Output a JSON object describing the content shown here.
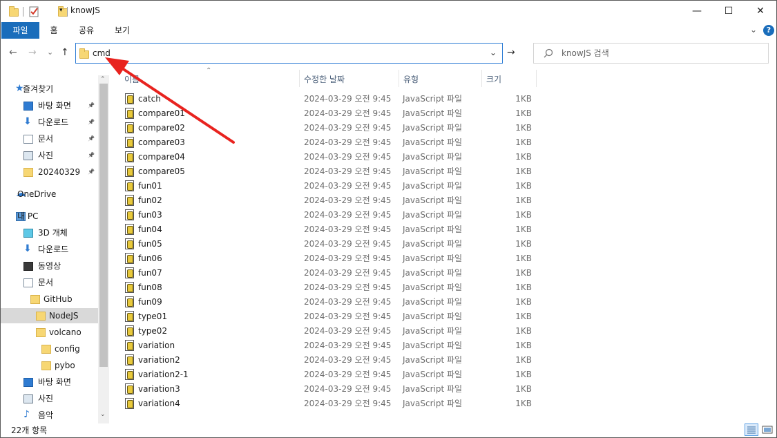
{
  "window": {
    "title": "knowJS",
    "minimize": "—",
    "maximize": "☐",
    "close": "✕"
  },
  "ribbon": {
    "tabs": [
      "파일",
      "홈",
      "공유",
      "보기"
    ],
    "expand_glyph": "⌄",
    "help_glyph": "?"
  },
  "navbar": {
    "back": "←",
    "forward": "→",
    "recent": "⌄",
    "up": "↑",
    "address": "cmd",
    "address_dropdown": "⌄",
    "go": "→",
    "search_placeholder": "knowJS 검색",
    "search_icon": "search-icon"
  },
  "sidebar": {
    "items": [
      {
        "label": "즐겨찾기",
        "icon": "star-icon",
        "pinned": false
      },
      {
        "label": "바탕 화면",
        "icon": "desktop-icon",
        "pinned": true
      },
      {
        "label": "다운로드",
        "icon": "download-icon",
        "pinned": true
      },
      {
        "label": "문서",
        "icon": "document-icon",
        "pinned": true
      },
      {
        "label": "사진",
        "icon": "picture-icon",
        "pinned": true
      },
      {
        "label": "20240329",
        "icon": "folder-icon",
        "pinned": true
      },
      {
        "label": "OneDrive",
        "icon": "cloud-icon",
        "pinned": false
      },
      {
        "label": "내 PC",
        "icon": "pc-icon",
        "pinned": false
      },
      {
        "label": "3D 개체",
        "icon": "3d-objects-icon",
        "pinned": false
      },
      {
        "label": "다운로드",
        "icon": "download-icon",
        "pinned": false
      },
      {
        "label": "동영상",
        "icon": "video-icon",
        "pinned": false
      },
      {
        "label": "문서",
        "icon": "document-icon",
        "pinned": false
      },
      {
        "label": "GitHub",
        "icon": "folder-icon",
        "pinned": false
      },
      {
        "label": "NodeJS",
        "icon": "folder-icon",
        "pinned": false,
        "selected": true
      },
      {
        "label": "volcano",
        "icon": "folder-icon",
        "pinned": false
      },
      {
        "label": "config",
        "icon": "folder-icon",
        "pinned": false
      },
      {
        "label": "pybo",
        "icon": "folder-icon",
        "pinned": false
      },
      {
        "label": "바탕 화면",
        "icon": "desktop-icon",
        "pinned": false
      },
      {
        "label": "사진",
        "icon": "picture-icon",
        "pinned": false
      },
      {
        "label": "음악",
        "icon": "music-icon",
        "pinned": false
      }
    ]
  },
  "columns": {
    "name": "이름",
    "date": "수정한 날짜",
    "type": "유형",
    "size": "크기"
  },
  "files": [
    {
      "name": "catch",
      "date": "2024-03-29 오전 9:45",
      "type": "JavaScript 파일",
      "size": "1KB"
    },
    {
      "name": "compare01",
      "date": "2024-03-29 오전 9:45",
      "type": "JavaScript 파일",
      "size": "1KB"
    },
    {
      "name": "compare02",
      "date": "2024-03-29 오전 9:45",
      "type": "JavaScript 파일",
      "size": "1KB"
    },
    {
      "name": "compare03",
      "date": "2024-03-29 오전 9:45",
      "type": "JavaScript 파일",
      "size": "1KB"
    },
    {
      "name": "compare04",
      "date": "2024-03-29 오전 9:45",
      "type": "JavaScript 파일",
      "size": "1KB"
    },
    {
      "name": "compare05",
      "date": "2024-03-29 오전 9:45",
      "type": "JavaScript 파일",
      "size": "1KB"
    },
    {
      "name": "fun01",
      "date": "2024-03-29 오전 9:45",
      "type": "JavaScript 파일",
      "size": "1KB"
    },
    {
      "name": "fun02",
      "date": "2024-03-29 오전 9:45",
      "type": "JavaScript 파일",
      "size": "1KB"
    },
    {
      "name": "fun03",
      "date": "2024-03-29 오전 9:45",
      "type": "JavaScript 파일",
      "size": "1KB"
    },
    {
      "name": "fun04",
      "date": "2024-03-29 오전 9:45",
      "type": "JavaScript 파일",
      "size": "1KB"
    },
    {
      "name": "fun05",
      "date": "2024-03-29 오전 9:45",
      "type": "JavaScript 파일",
      "size": "1KB"
    },
    {
      "name": "fun06",
      "date": "2024-03-29 오전 9:45",
      "type": "JavaScript 파일",
      "size": "1KB"
    },
    {
      "name": "fun07",
      "date": "2024-03-29 오전 9:45",
      "type": "JavaScript 파일",
      "size": "1KB"
    },
    {
      "name": "fun08",
      "date": "2024-03-29 오전 9:45",
      "type": "JavaScript 파일",
      "size": "1KB"
    },
    {
      "name": "fun09",
      "date": "2024-03-29 오전 9:45",
      "type": "JavaScript 파일",
      "size": "1KB"
    },
    {
      "name": "type01",
      "date": "2024-03-29 오전 9:45",
      "type": "JavaScript 파일",
      "size": "1KB"
    },
    {
      "name": "type02",
      "date": "2024-03-29 오전 9:45",
      "type": "JavaScript 파일",
      "size": "1KB"
    },
    {
      "name": "variation",
      "date": "2024-03-29 오전 9:45",
      "type": "JavaScript 파일",
      "size": "1KB"
    },
    {
      "name": "variation2",
      "date": "2024-03-29 오전 9:45",
      "type": "JavaScript 파일",
      "size": "1KB"
    },
    {
      "name": "variation2-1",
      "date": "2024-03-29 오전 9:45",
      "type": "JavaScript 파일",
      "size": "1KB"
    },
    {
      "name": "variation3",
      "date": "2024-03-29 오전 9:45",
      "type": "JavaScript 파일",
      "size": "1KB"
    },
    {
      "name": "variation4",
      "date": "2024-03-29 오전 9:45",
      "type": "JavaScript 파일",
      "size": "1KB"
    }
  ],
  "status": {
    "count": "22개 항목"
  },
  "colors": {
    "accent": "#1a6dbb",
    "annotation_arrow": "#e8231f"
  }
}
